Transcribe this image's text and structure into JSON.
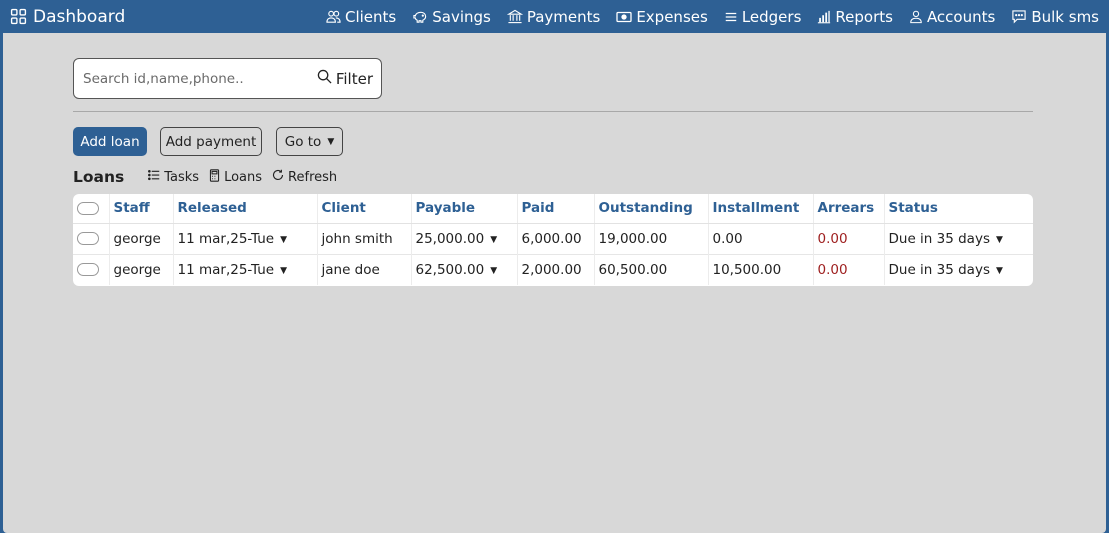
{
  "topbar": {
    "brand": "Dashboard",
    "nav": [
      {
        "label": "Clients",
        "icon": "people-icon"
      },
      {
        "label": "Savings",
        "icon": "piggy-bank-icon"
      },
      {
        "label": "Payments",
        "icon": "bank-icon"
      },
      {
        "label": "Expenses",
        "icon": "cash-icon"
      },
      {
        "label": "Ledgers",
        "icon": "list-icon"
      },
      {
        "label": "Reports",
        "icon": "bar-chart-icon"
      },
      {
        "label": "Accounts",
        "icon": "person-icon"
      },
      {
        "label": "Bulk sms",
        "icon": "chat-icon"
      }
    ]
  },
  "search": {
    "placeholder": "Search id,name,phone..",
    "value": "",
    "filter_label": "Filter"
  },
  "actions": {
    "add_loan": "Add loan",
    "add_payment": "Add payment",
    "go_to": "Go to"
  },
  "loans_bar": {
    "title": "Loans",
    "tasks": "Tasks",
    "loans": "Loans",
    "refresh": "Refresh"
  },
  "table": {
    "headers": [
      "Staff",
      "Released",
      "Client",
      "Payable",
      "Paid",
      "Outstanding",
      "Installment",
      "Arrears",
      "Status"
    ],
    "rows": [
      {
        "staff": "george",
        "released": "11 mar,25-Tue",
        "client": "john smith",
        "payable": "25,000.00",
        "paid": "6,000.00",
        "outstanding": "19,000.00",
        "installment": "0.00",
        "arrears": "0.00",
        "status": "Due in 35 days"
      },
      {
        "staff": "george",
        "released": "11 mar,25-Tue",
        "client": "jane doe",
        "payable": "62,500.00",
        "paid": "2,000.00",
        "outstanding": "60,500.00",
        "installment": "10,500.00",
        "arrears": "0.00",
        "status": "Due in 35 days"
      }
    ]
  },
  "colors": {
    "primary": "#2e6094",
    "background": "#d8d8d8",
    "arrears": "#9e1f1f"
  }
}
